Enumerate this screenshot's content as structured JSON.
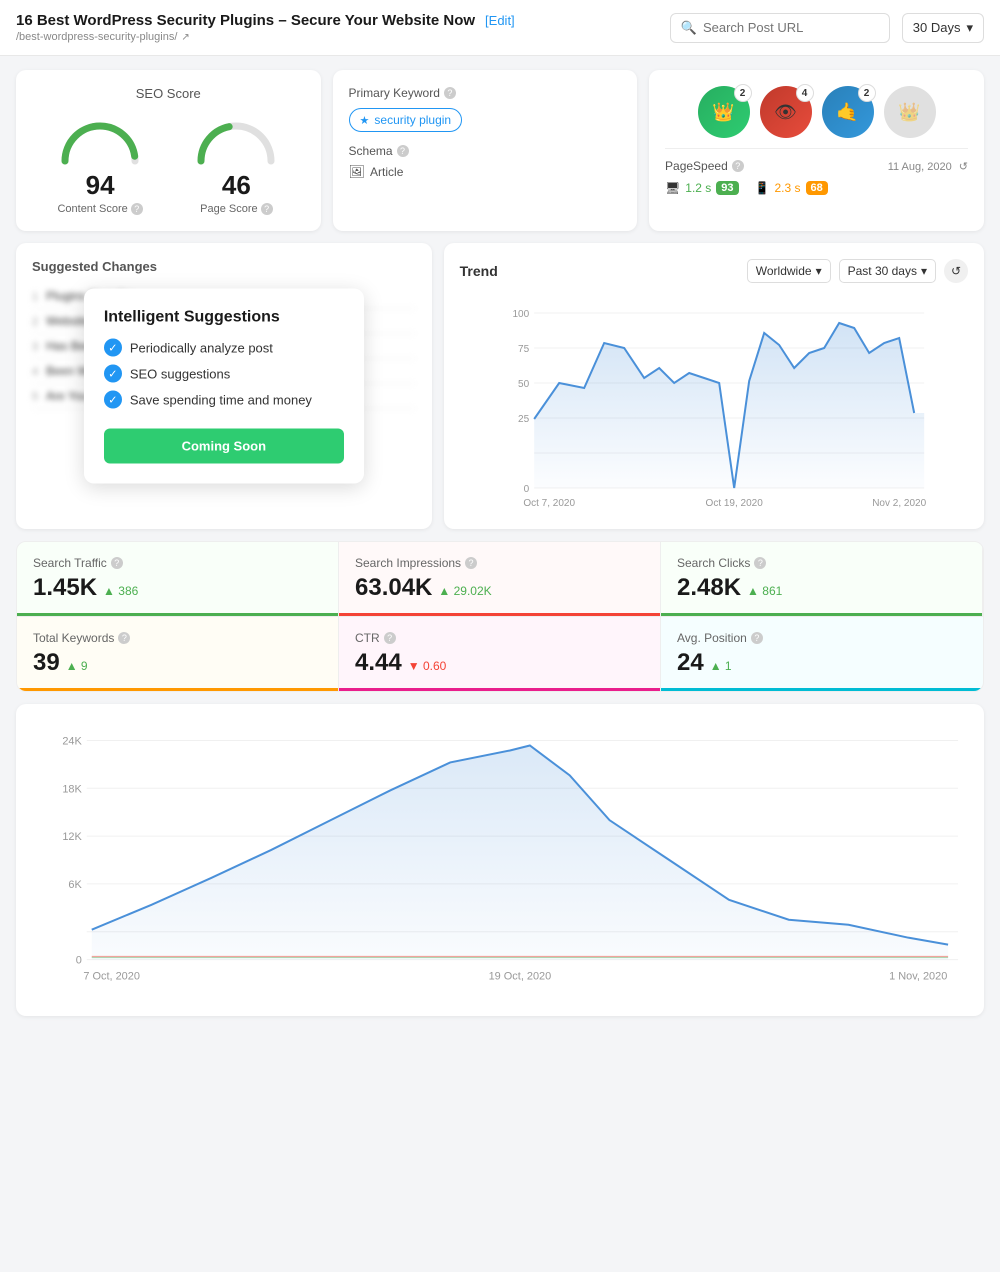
{
  "header": {
    "title": "16 Best WordPress Security Plugins – Secure Your Website Now",
    "edit_label": "[Edit]",
    "url": "/best-wordpress-security-plugins/",
    "search_placeholder": "Search Post URL",
    "days_label": "30 Days"
  },
  "seo_score": {
    "title": "SEO Score",
    "content_score": "94",
    "content_label": "Content Score",
    "page_score": "46",
    "page_label": "Page Score"
  },
  "primary_keyword": {
    "label": "Primary Keyword",
    "keyword": "security plugin",
    "schema_label": "Schema",
    "schema_value": "Article"
  },
  "badges": [
    {
      "emoji": "👑",
      "bg": "#2ecc71",
      "count": "2"
    },
    {
      "emoji": "👁",
      "bg": "#e74c3c",
      "count": "4"
    },
    {
      "emoji": "🤙",
      "bg": "#3498db",
      "count": "2"
    },
    {
      "emoji": "👑",
      "bg": "#bdc3c7",
      "count": ""
    }
  ],
  "pagespeed": {
    "label": "PageSpeed",
    "date": "11 Aug, 2020",
    "desktop_time": "1.2 s",
    "desktop_score": "93",
    "mobile_time": "2.3 s",
    "mobile_score": "68"
  },
  "suggested": {
    "title": "Suggested Changes",
    "items": [
      "Plugins That Giv...",
      "Website With...",
      "Has Been Wri..."
    ],
    "popup": {
      "title": "Intelligent Suggestions",
      "items": [
        "Periodically analyze post",
        "SEO suggestions",
        "Save spending time and money"
      ],
      "button": "Coming Soon"
    }
  },
  "trend": {
    "title": "Trend",
    "region": "Worldwide",
    "period": "Past 30 days",
    "y_labels": [
      "100",
      "75",
      "50",
      "25",
      "0"
    ],
    "x_labels": [
      "Oct 7, 2020",
      "Oct 19, 2020",
      "Nov 2, 2020"
    ]
  },
  "stats": [
    {
      "label": "Search Traffic",
      "value": "1.45K",
      "change": "386",
      "dir": "up",
      "bar": "green"
    },
    {
      "label": "Search Impressions",
      "value": "63.04K",
      "change": "29.02K",
      "dir": "up",
      "bar": "red"
    },
    {
      "label": "Search Clicks",
      "value": "2.48K",
      "change": "861",
      "dir": "up",
      "bar": "green"
    },
    {
      "label": "Total Keywords",
      "value": "39",
      "change": "9",
      "dir": "up",
      "bar": "orange"
    },
    {
      "label": "CTR",
      "value": "4.44",
      "change": "0.60",
      "dir": "down",
      "bar": "pink"
    },
    {
      "label": "Avg. Position",
      "value": "24",
      "change": "1",
      "dir": "up",
      "bar": "teal"
    }
  ],
  "bottom_chart": {
    "y_labels": [
      "24K",
      "18K",
      "12K",
      "6K",
      "0"
    ],
    "x_labels": [
      "7 Oct, 2020",
      "19 Oct, 2020",
      "1 Nov, 2020"
    ]
  }
}
